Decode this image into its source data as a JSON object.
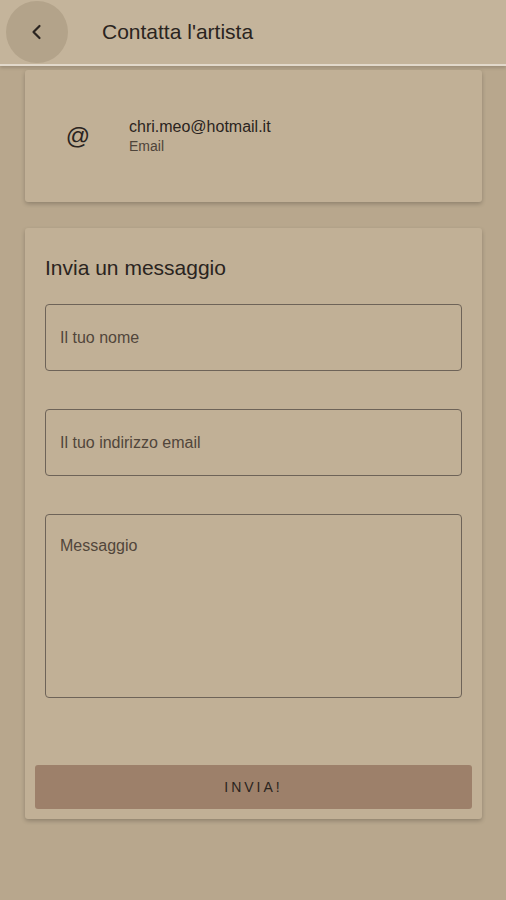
{
  "header": {
    "title": "Contatta l'artista"
  },
  "contact": {
    "icon": "@",
    "value": "chri.meo@hotmail.it",
    "label": "Email"
  },
  "form": {
    "title": "Invia un messaggio",
    "fields": [
      {
        "placeholder": "Il tuo nome",
        "kind": "input"
      },
      {
        "placeholder": "Il tuo indirizzo email",
        "kind": "input"
      },
      {
        "placeholder": "Messaggio",
        "kind": "textarea"
      }
    ],
    "button": "INVIA!"
  }
}
